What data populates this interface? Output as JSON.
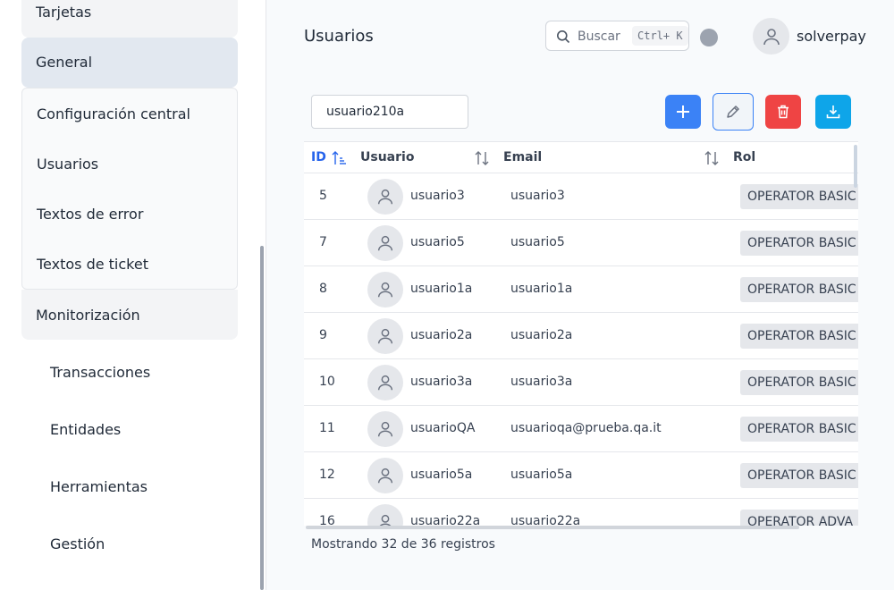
{
  "sidebar": {
    "top_item": "Tarjetas",
    "general": "General",
    "sub_items": [
      "Configuración central",
      "Usuarios",
      "Textos de error",
      "Textos de ticket"
    ],
    "monitoring": "Monitorización",
    "sections": [
      "Transacciones",
      "Entidades",
      "Herramientas",
      "Gestión"
    ]
  },
  "header": {
    "title": "Usuarios",
    "search_placeholder": "Buscar",
    "search_shortcut": "Ctrl+ K",
    "username": "solverpay",
    "status_color": "#9ca3af"
  },
  "toolbar": {
    "filter_value": "usuario210a",
    "buttons": {
      "add": {
        "icon": "plus-icon",
        "color": "#3b82f6"
      },
      "edit": {
        "icon": "pencil-icon",
        "color": "#3b82f6"
      },
      "delete": {
        "icon": "trash-icon",
        "color": "#ef4444"
      },
      "export": {
        "icon": "download-icon",
        "color": "#0ea5e9"
      }
    }
  },
  "table": {
    "columns": {
      "id": "ID",
      "user": "Usuario",
      "email": "Email",
      "role": "Rol"
    },
    "rows": [
      {
        "id": "5",
        "user": "usuario3",
        "email": "usuario3",
        "role": "OPERATOR BASIC"
      },
      {
        "id": "7",
        "user": "usuario5",
        "email": "usuario5",
        "role": "OPERATOR BASIC"
      },
      {
        "id": "8",
        "user": "usuario1a",
        "email": "usuario1a",
        "role": "OPERATOR BASIC"
      },
      {
        "id": "9",
        "user": "usuario2a",
        "email": "usuario2a",
        "role": "OPERATOR BASIC"
      },
      {
        "id": "10",
        "user": "usuario3a",
        "email": "usuario3a",
        "role": "OPERATOR BASIC"
      },
      {
        "id": "11",
        "user": "usuarioQA",
        "email": "usuarioqa@prueba.qa.it",
        "role": "OPERATOR BASIC"
      },
      {
        "id": "12",
        "user": "usuario5a",
        "email": "usuario5a",
        "role": "OPERATOR BASIC"
      },
      {
        "id": "16",
        "user": "usuario22a",
        "email": "usuario22a",
        "role": "OPERATOR ADVA"
      }
    ]
  },
  "footer": {
    "summary": "Mostrando 32 de 36 registros"
  }
}
